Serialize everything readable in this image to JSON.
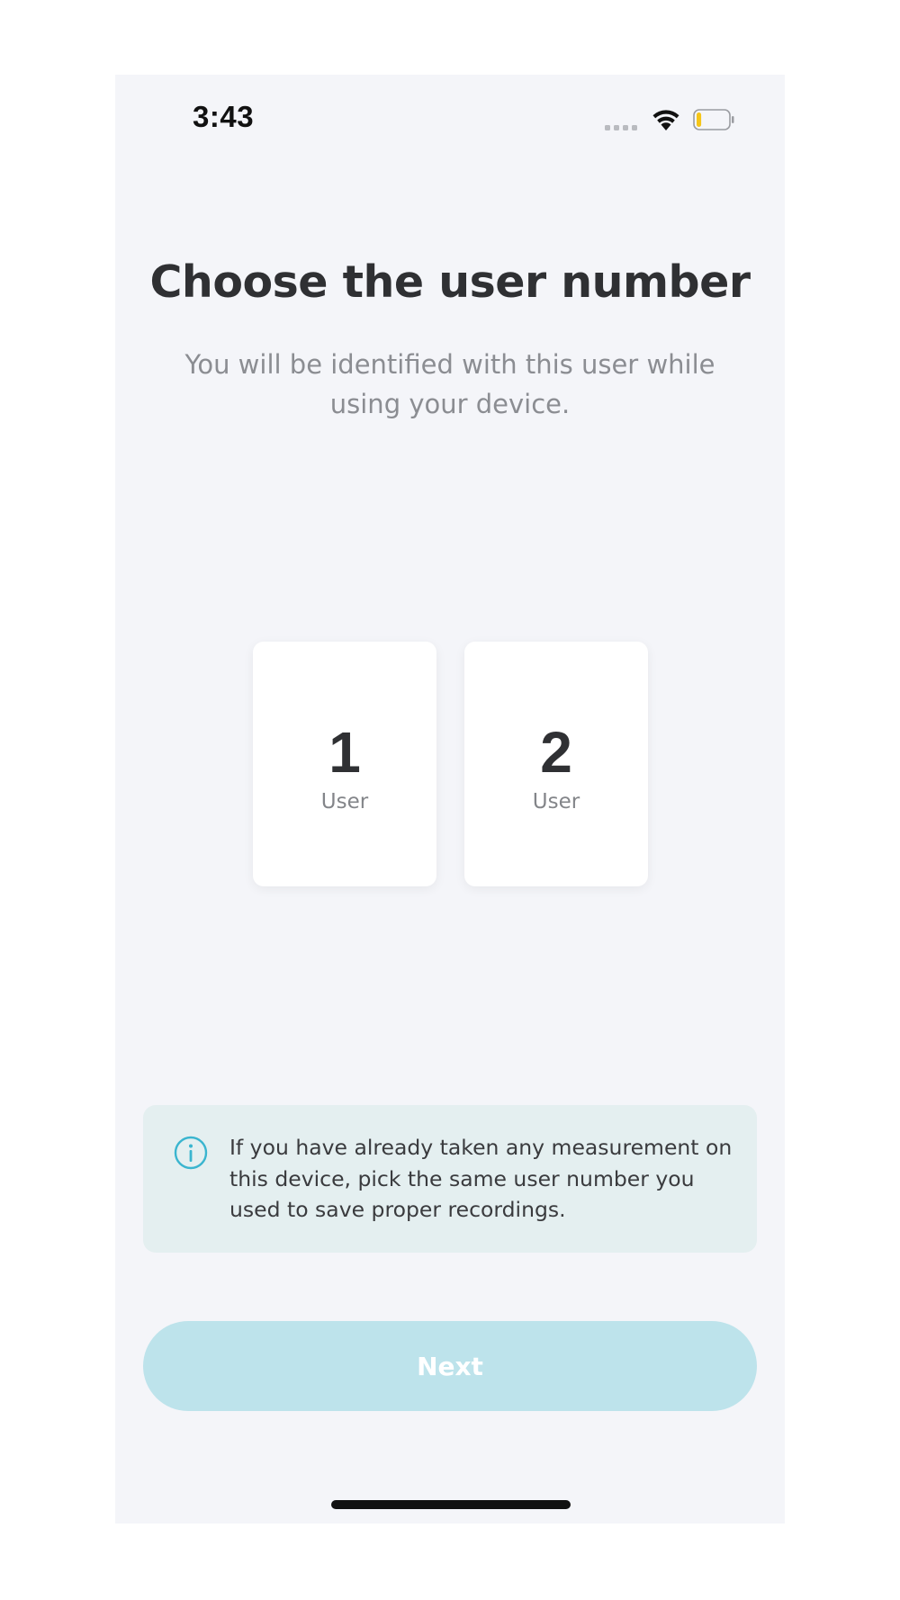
{
  "status_bar": {
    "time": "3:43",
    "signal_icon": "cellular-signal-icon",
    "wifi_icon": "wifi-icon",
    "battery_icon": "battery-low-icon",
    "battery_level": 0.15,
    "battery_color": "#f5c518"
  },
  "header": {
    "title": "Choose the user number",
    "subtitle": "You will be identified with this user while using your device."
  },
  "users": [
    {
      "number": "1",
      "label": "User"
    },
    {
      "number": "2",
      "label": "User"
    }
  ],
  "info": {
    "icon": "info-icon",
    "text": "If you have already taken any measurement on this device, pick the same user number you used to save proper recordings.",
    "accent_color": "#3ab5cf"
  },
  "footer": {
    "next_label": "Next",
    "next_color": "#bde3eb"
  }
}
